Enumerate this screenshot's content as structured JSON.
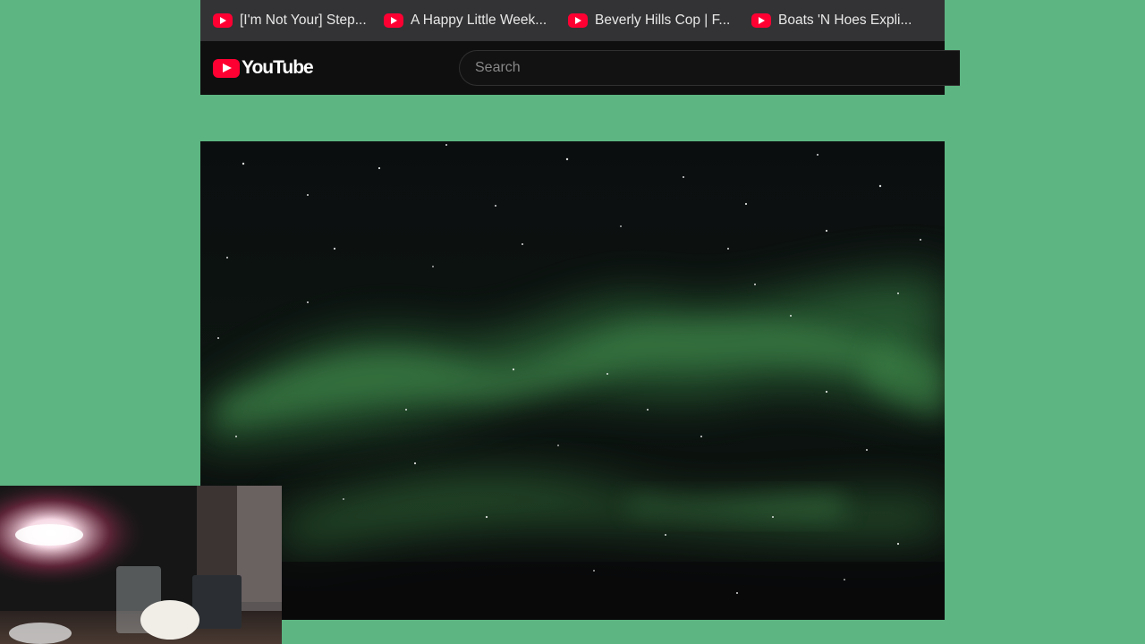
{
  "bookmarks": [
    {
      "label": "[I'm Not Your] Step...",
      "icon": "youtube-favicon"
    },
    {
      "label": "A Happy Little Week...",
      "icon": "youtube-favicon"
    },
    {
      "label": "Beverly Hills Cop | F...",
      "icon": "youtube-favicon"
    },
    {
      "label": "Boats 'N Hoes Expli...",
      "icon": "youtube-favicon"
    }
  ],
  "masthead": {
    "logo_text": "YouTube",
    "search_placeholder": "Search"
  },
  "colors": {
    "background": "#5db582",
    "youtube_red": "#ff0033",
    "aurora_green": "#3f8f4a"
  }
}
